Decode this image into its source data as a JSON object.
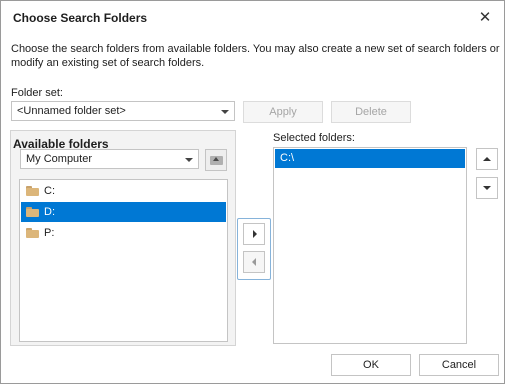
{
  "dialog": {
    "title": "Choose Search Folders",
    "close_glyph": "✕",
    "description": "Choose the search folders from available folders. You may also create a new set of search folders or modify an existing set of search folders."
  },
  "folder_set": {
    "label": "Folder set:",
    "value": "<Unnamed folder set>",
    "apply_label": "Apply",
    "delete_label": "Delete"
  },
  "available": {
    "title": "Available folders",
    "location": "My Computer",
    "items": [
      {
        "label": "C:",
        "selected": false
      },
      {
        "label": "D:",
        "selected": true
      },
      {
        "label": "P:",
        "selected": false
      }
    ]
  },
  "selected": {
    "label": "Selected folders:",
    "items": [
      "C:\\"
    ]
  },
  "footer": {
    "ok_label": "OK",
    "cancel_label": "Cancel"
  },
  "icons": {
    "close": "close-icon",
    "folder": "folder-icon",
    "up_folder": "folder-up-icon",
    "add": "arrow-right-icon",
    "remove": "arrow-left-icon",
    "move_up": "arrow-up-icon",
    "move_down": "arrow-down-icon"
  },
  "colors": {
    "selection": "#0078d4",
    "folder": "#dcb67a",
    "group_background": "#f3f3f3"
  }
}
